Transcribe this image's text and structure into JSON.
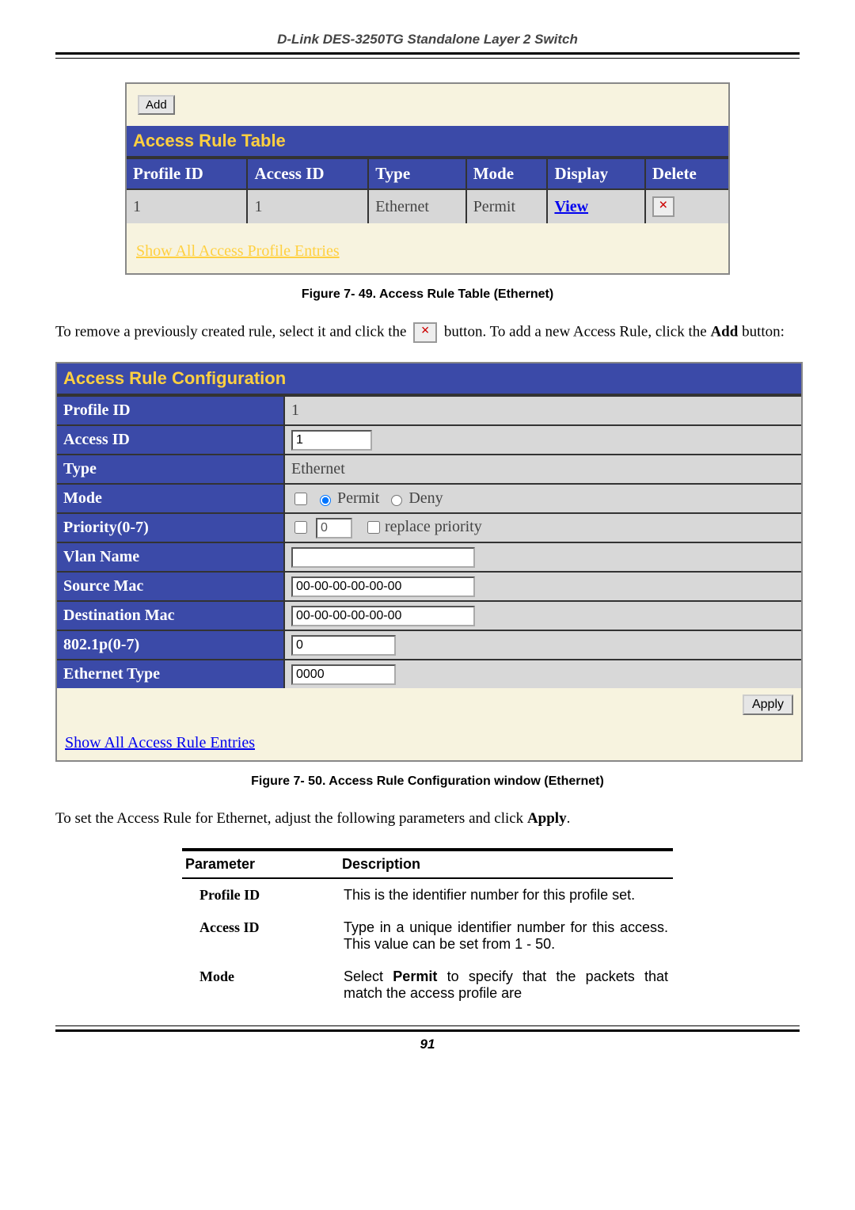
{
  "header": "D-Link DES-3250TG Standalone Layer 2 Switch",
  "fig1": {
    "addLabel": "Add",
    "title": "Access Rule Table",
    "cols": [
      "Profile ID",
      "Access ID",
      "Type",
      "Mode",
      "Display",
      "Delete"
    ],
    "row": {
      "profile": "1",
      "access": "1",
      "type": "Ethernet",
      "mode": "Permit",
      "view": "View"
    },
    "showAll": "Show All Access Profile Entries",
    "caption": "Figure 7- 49. Access Rule Table (Ethernet)"
  },
  "para1a": "To remove a previously created rule, select it and click the ",
  "para1b": " button. To add a new Access Rule, click the ",
  "para1c": " button:",
  "addWord": "Add",
  "cfg": {
    "title": "Access Rule Configuration",
    "rows": {
      "profileId": {
        "label": "Profile ID",
        "value": "1"
      },
      "accessId": {
        "label": "Access ID",
        "value": "1"
      },
      "type": {
        "label": "Type",
        "value": "Ethernet"
      },
      "mode": {
        "label": "Mode",
        "permit": "Permit",
        "deny": "Deny"
      },
      "priority": {
        "label": "Priority(0-7)",
        "value": "0",
        "replace": "replace priority"
      },
      "vlan": {
        "label": "Vlan Name",
        "value": ""
      },
      "srcMac": {
        "label": "Source Mac",
        "value": "00-00-00-00-00-00"
      },
      "dstMac": {
        "label": "Destination Mac",
        "value": "00-00-00-00-00-00"
      },
      "dot1p": {
        "label": "802.1p(0-7)",
        "value": "0"
      },
      "ethType": {
        "label": "Ethernet Type",
        "value": "0000"
      }
    },
    "apply": "Apply",
    "showAll": "Show All Access Rule Entries",
    "caption": "Figure 7- 50. Access Rule Configuration window (Ethernet)"
  },
  "para2a": "To set the Access Rule for Ethernet, adjust the following parameters and click ",
  "para2b": ".",
  "applyWord": "Apply",
  "ptable": {
    "h1": "Parameter",
    "h2": "Description",
    "rows": [
      {
        "p": "Profile ID",
        "d": "This is the identifier number for this profile set."
      },
      {
        "p": "Access ID",
        "d": "Type in a unique identifier number for this access. This value can be set from 1 - 50."
      },
      {
        "p": "Mode",
        "d": "Select Permit to specify that the packets that match the access profile are"
      }
    ]
  },
  "pageNum": "91"
}
